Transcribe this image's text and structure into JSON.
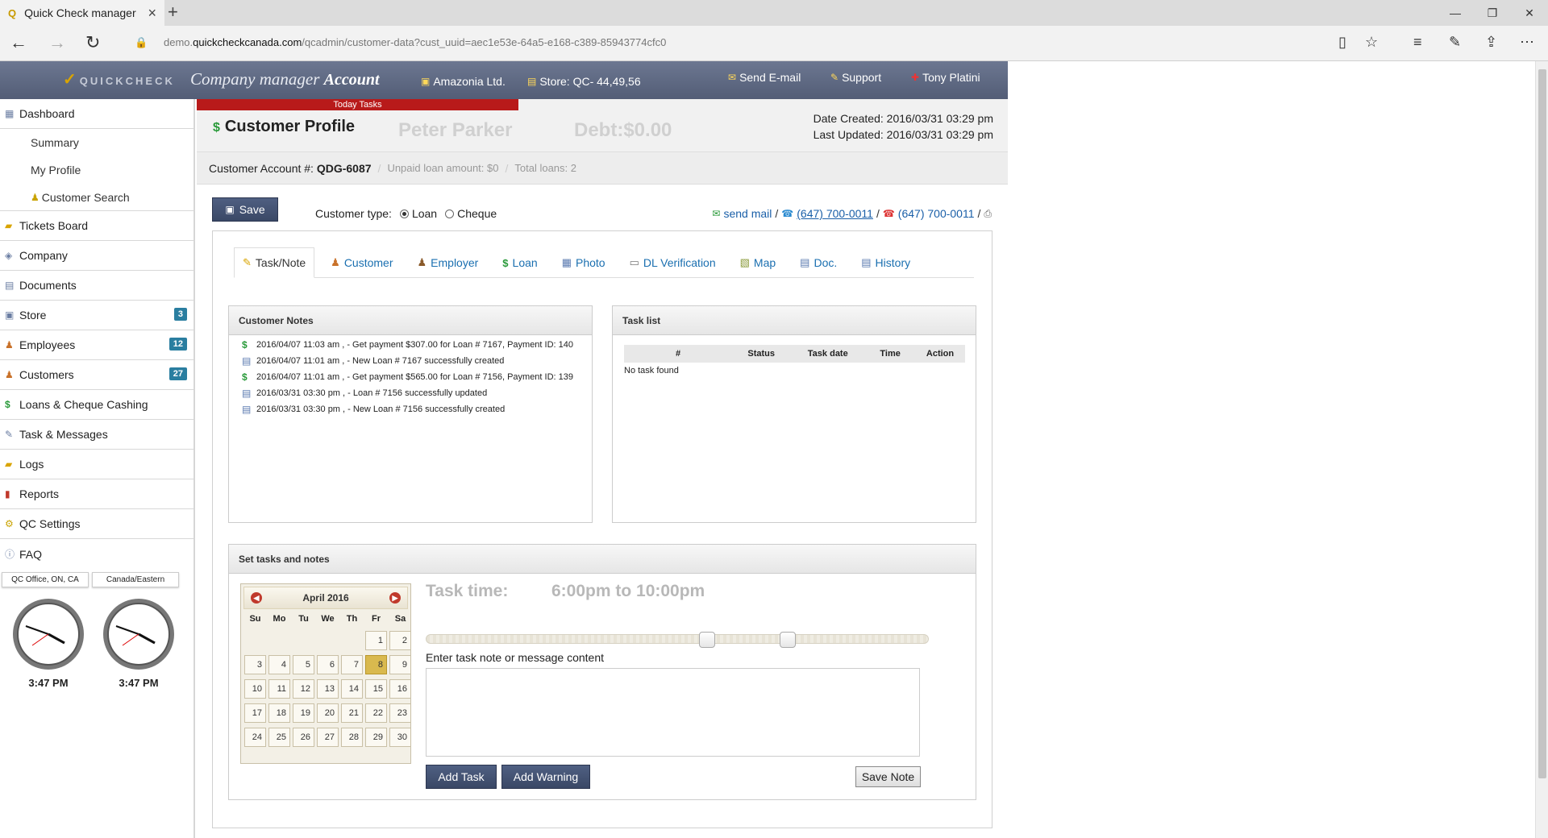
{
  "browser": {
    "tab_title": "Quick Check manager",
    "url_prefix": "demo.",
    "url_domain": "quickcheckcanada.com",
    "url_path": "/qcadmin/customer-data?cust_uuid=aec1e53e-64a5-e168-c389-85943774cfc0"
  },
  "header": {
    "logo": "QUICKCHECK",
    "title": "Company manager ",
    "title_bold": "Account",
    "company": "Amazonia Ltd.",
    "store": "Store: QC- 44,49,56",
    "send_email": "Send E-mail",
    "support": "Support",
    "user": "Tony Platini"
  },
  "sidebar": {
    "dashboard": "Dashboard",
    "sub": [
      "Summary",
      "My Profile",
      "Customer Search"
    ],
    "items": [
      {
        "label": "Tickets Board",
        "badge": ""
      },
      {
        "label": "Company",
        "badge": ""
      },
      {
        "label": "Documents",
        "badge": ""
      },
      {
        "label": "Store",
        "badge": "3"
      },
      {
        "label": "Employees",
        "badge": "12"
      },
      {
        "label": "Customers",
        "badge": "27"
      },
      {
        "label": "Loans & Cheque Cashing",
        "badge": ""
      },
      {
        "label": "Task & Messages",
        "badge": ""
      },
      {
        "label": "Logs",
        "badge": ""
      },
      {
        "label": "Reports",
        "badge": ""
      },
      {
        "label": "QC Settings",
        "badge": ""
      },
      {
        "label": "FAQ",
        "badge": ""
      }
    ],
    "tz": [
      "QC Office, ON, CA",
      "Canada/Eastern"
    ],
    "clock_times": [
      "3:47 PM",
      "3:47 PM"
    ]
  },
  "profile": {
    "today_tasks": "Today Tasks",
    "title": "Customer Profile",
    "name": "Peter Parker",
    "debt": "Debt:$0.00",
    "date_created": "Date Created: 2016/03/31 03:29 pm",
    "last_updated": "Last Updated: 2016/03/31 03:29 pm",
    "account_label": "Customer Account #:",
    "account_no": "QDG-6087",
    "unpaid": "Unpaid loan amount: $0",
    "total_loans": "Total loans: 2"
  },
  "toolbar": {
    "save": "Save",
    "customer_type_label": "Customer type:",
    "opt_loan": "Loan",
    "opt_cheque": "Cheque",
    "send_mail": "send mail",
    "phone1": "(647) 700-0011",
    "phone2": "(647) 700-0011"
  },
  "tabs": [
    "Task/Note",
    "Customer",
    "Employer",
    "Loan",
    "Photo",
    "DL Verification",
    "Map",
    "Doc.",
    "History"
  ],
  "notes": {
    "title": "Customer Notes",
    "rows": [
      {
        "icon": "dollar",
        "text": "2016/04/07 11:03 am , - Get payment $307.00 for Loan # 7167, Payment ID: 140"
      },
      {
        "icon": "doc",
        "text": "2016/04/07 11:01 am , - New Loan # 7167 successfully created"
      },
      {
        "icon": "dollar",
        "text": "2016/04/07 11:01 am , - Get payment $565.00 for Loan # 7156, Payment ID: 139"
      },
      {
        "icon": "doc",
        "text": "2016/03/31 03:30 pm , - Loan # 7156 successfully updated"
      },
      {
        "icon": "doc",
        "text": "2016/03/31 03:30 pm , - New Loan # 7156 successfully created"
      }
    ]
  },
  "tasks": {
    "title": "Task list",
    "columns": [
      "#",
      "Status",
      "Task date",
      "Time",
      "Action"
    ],
    "empty": "No task found"
  },
  "set_tasks": {
    "title": "Set tasks and notes",
    "calendar_month": "April 2016",
    "dow": [
      "Su",
      "Mo",
      "Tu",
      "We",
      "Th",
      "Fr",
      "Sa"
    ],
    "today": 8,
    "task_time_label": "Task time:",
    "task_time_value": "6:00pm to 10:00pm",
    "slider_range": [
      0.56,
      0.72
    ],
    "note_label": "Enter task note or message content",
    "add_task": "Add Task",
    "add_warning": "Add Warning",
    "save_note": "Save Note"
  }
}
